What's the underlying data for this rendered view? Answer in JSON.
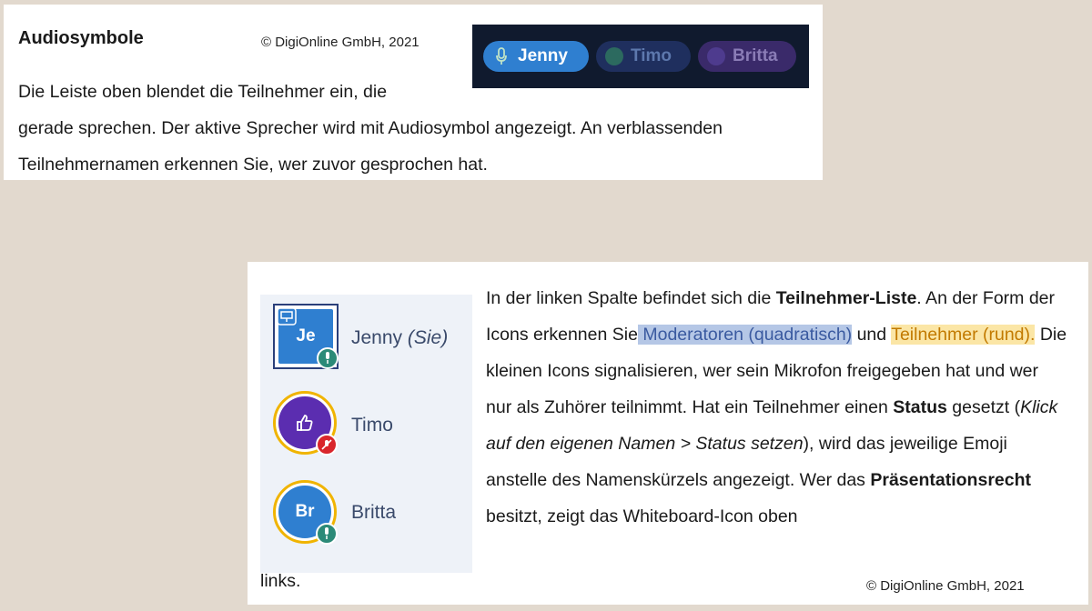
{
  "card1": {
    "title": "Audiosymbole",
    "copyright": "© DigiOnline GmbH, 2021",
    "para_line1": "Die Leiste oben blendet die Teilnehmer ein, die",
    "para_rest": "gerade sprechen. Der aktive Sprecher wird mit Audiosymbol angezeigt. An verblassenden Teilnehmernamen erkennen Sie, wer zuvor gesprochen hat.",
    "speakers": [
      {
        "name": "Jenny",
        "state": "active",
        "icon": "microphone-icon"
      },
      {
        "name": "Timo",
        "state": "faded"
      },
      {
        "name": "Britta",
        "state": "faded"
      }
    ]
  },
  "card2": {
    "participants": [
      {
        "initials": "Je",
        "name": "Jenny",
        "suffix": "(Sie)",
        "role": "moderator",
        "badge": "microphone-icon",
        "extra_icon": "whiteboard-icon"
      },
      {
        "initials": "",
        "name": "Timo",
        "role": "participant",
        "badge": "muted-icon",
        "emoji": "thumbs-up-icon"
      },
      {
        "initials": "Br",
        "name": "Britta",
        "role": "participant",
        "badge": "microphone-icon"
      }
    ],
    "text": {
      "s1a": "In der linken Spalte befindet sich die ",
      "s1b": "Teilnehmer-Liste",
      "s1c": ". An der Form der Icons erkennen Sie",
      "hl1": " Moderatoren (quadratisch)",
      "s2a": " und ",
      "hl2": "Teilnehmer (rund).",
      "s2b": " Die kleinen Icons signalisieren, wer sein Mikrofon freigegeben hat und wer nur als Zuhörer teilnimmt. Hat ein Teilnehmer einen ",
      "s2c": "Status",
      "s2d": " gesetzt (",
      "s2e": "Klick auf den eigenen Namen > Status setzen",
      "s2f": "), wird das jeweilige Emoji anstelle des Namenskürzels angezeigt. Wer das ",
      "s2g": "Präsentationsrecht",
      "s2h": " besitzt, zeigt das Whiteboard-Icon oben"
    },
    "links": "links.",
    "copyright": "© DigiOnline GmbH, 2021"
  },
  "colors": {
    "background": "#e2d9ce",
    "active_pill": "#2f7fd0",
    "bar": "#101a2e",
    "highlight_blue": "#b5c7e6",
    "highlight_yellow": "#fbe6a6",
    "ring": "#f0b400"
  }
}
